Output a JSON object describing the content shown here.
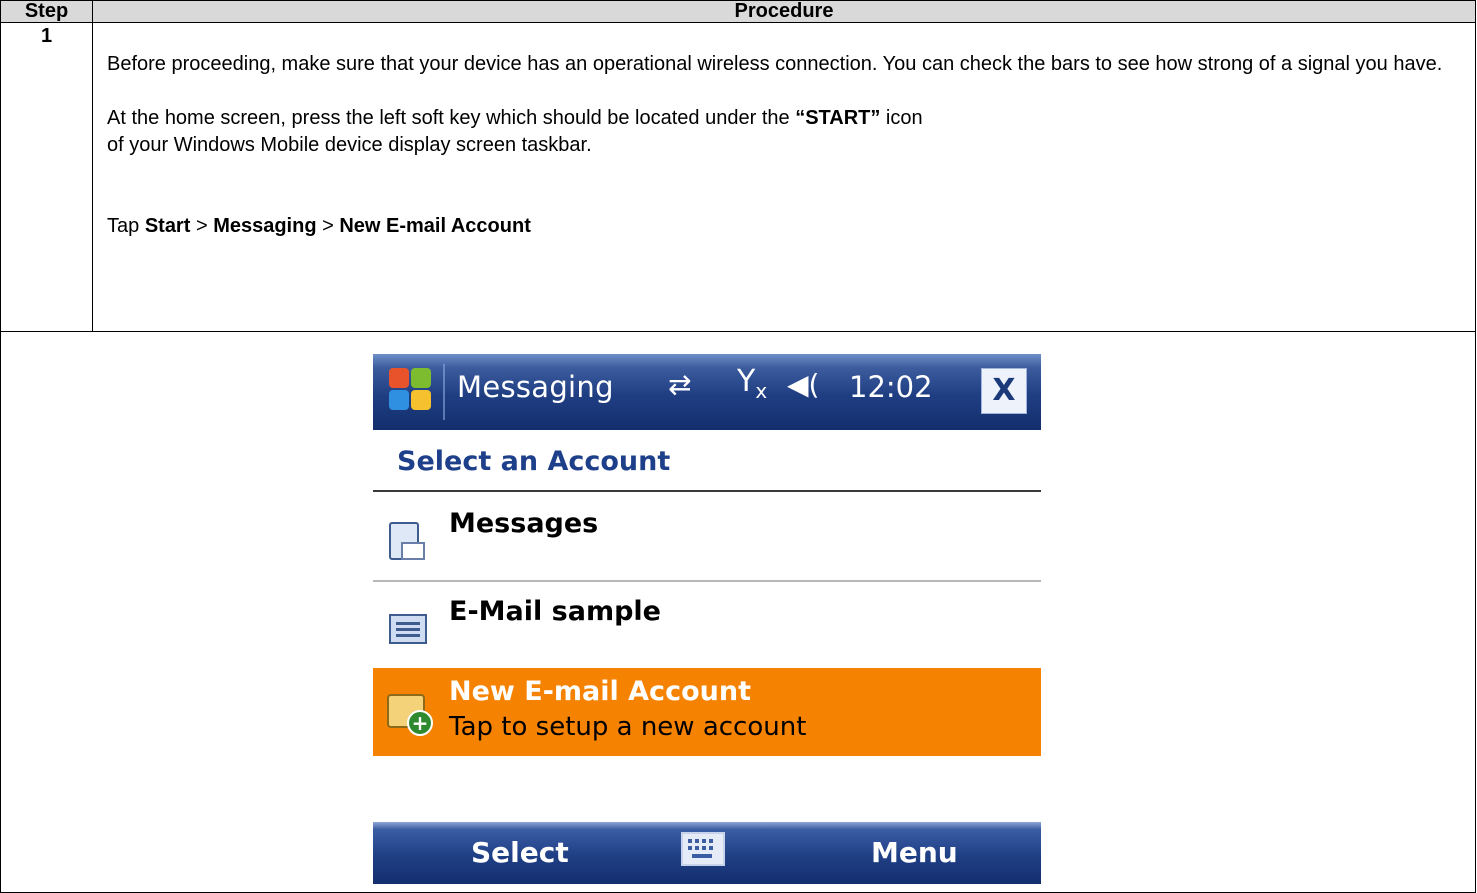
{
  "table": {
    "col_step": "Step",
    "col_procedure": "Procedure",
    "step_number": "1",
    "para1": "Before proceeding, make sure that your device has an operational wireless connection.   You can check the bars to see how strong of a signal you have.",
    "para2_lead": "At the home screen, press the left soft key which should be located under the ",
    "para2_bold": "“START”",
    "para2_tail": " icon",
    "para3": "of your Windows Mobile device display screen taskbar.",
    "tap_prefix": "Tap ",
    "tap_start": "Start",
    "tap_sep1": " > ",
    "tap_messaging": "Messaging",
    "tap_sep2": " > ",
    "tap_new": "New E-mail Account"
  },
  "phone": {
    "title": "Messaging",
    "time": "12:02",
    "close": "X",
    "section_header": "Select an Account",
    "items": [
      {
        "title": "Messages",
        "icon": "messages-icon"
      },
      {
        "title": "E-Mail sample",
        "icon": "email-account-icon"
      },
      {
        "title": "New E-mail Account",
        "subtitle": "Tap to setup a new account",
        "icon": "new-account-icon",
        "selected": true
      }
    ],
    "softkey_left": "Select",
    "softkey_right": "Menu"
  },
  "colors": {
    "titlebar": "#1f3e82",
    "highlight": "#f58200",
    "header_text": "#1e3f8a"
  }
}
